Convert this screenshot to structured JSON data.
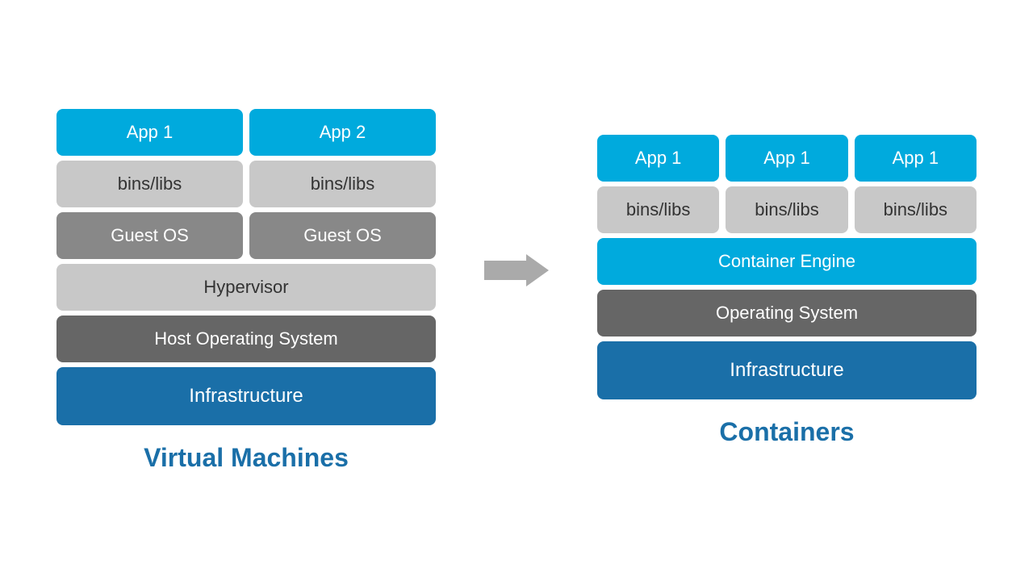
{
  "vm_section": {
    "title": "Virtual Machines",
    "stack": {
      "row1": [
        "App 1",
        "App 2"
      ],
      "row2": [
        "bins/libs",
        "bins/libs"
      ],
      "row3": [
        "Guest OS",
        "Guest OS"
      ],
      "row4": "Hypervisor",
      "row5": "Host Operating System",
      "row6": "Infrastructure"
    }
  },
  "container_section": {
    "title": "Containers",
    "stack": {
      "row1": [
        "App 1",
        "App 1",
        "App 1"
      ],
      "row2": [
        "bins/libs",
        "bins/libs",
        "bins/libs"
      ],
      "row3": "Container Engine",
      "row4": "Operating System",
      "row5": "Infrastructure"
    }
  }
}
